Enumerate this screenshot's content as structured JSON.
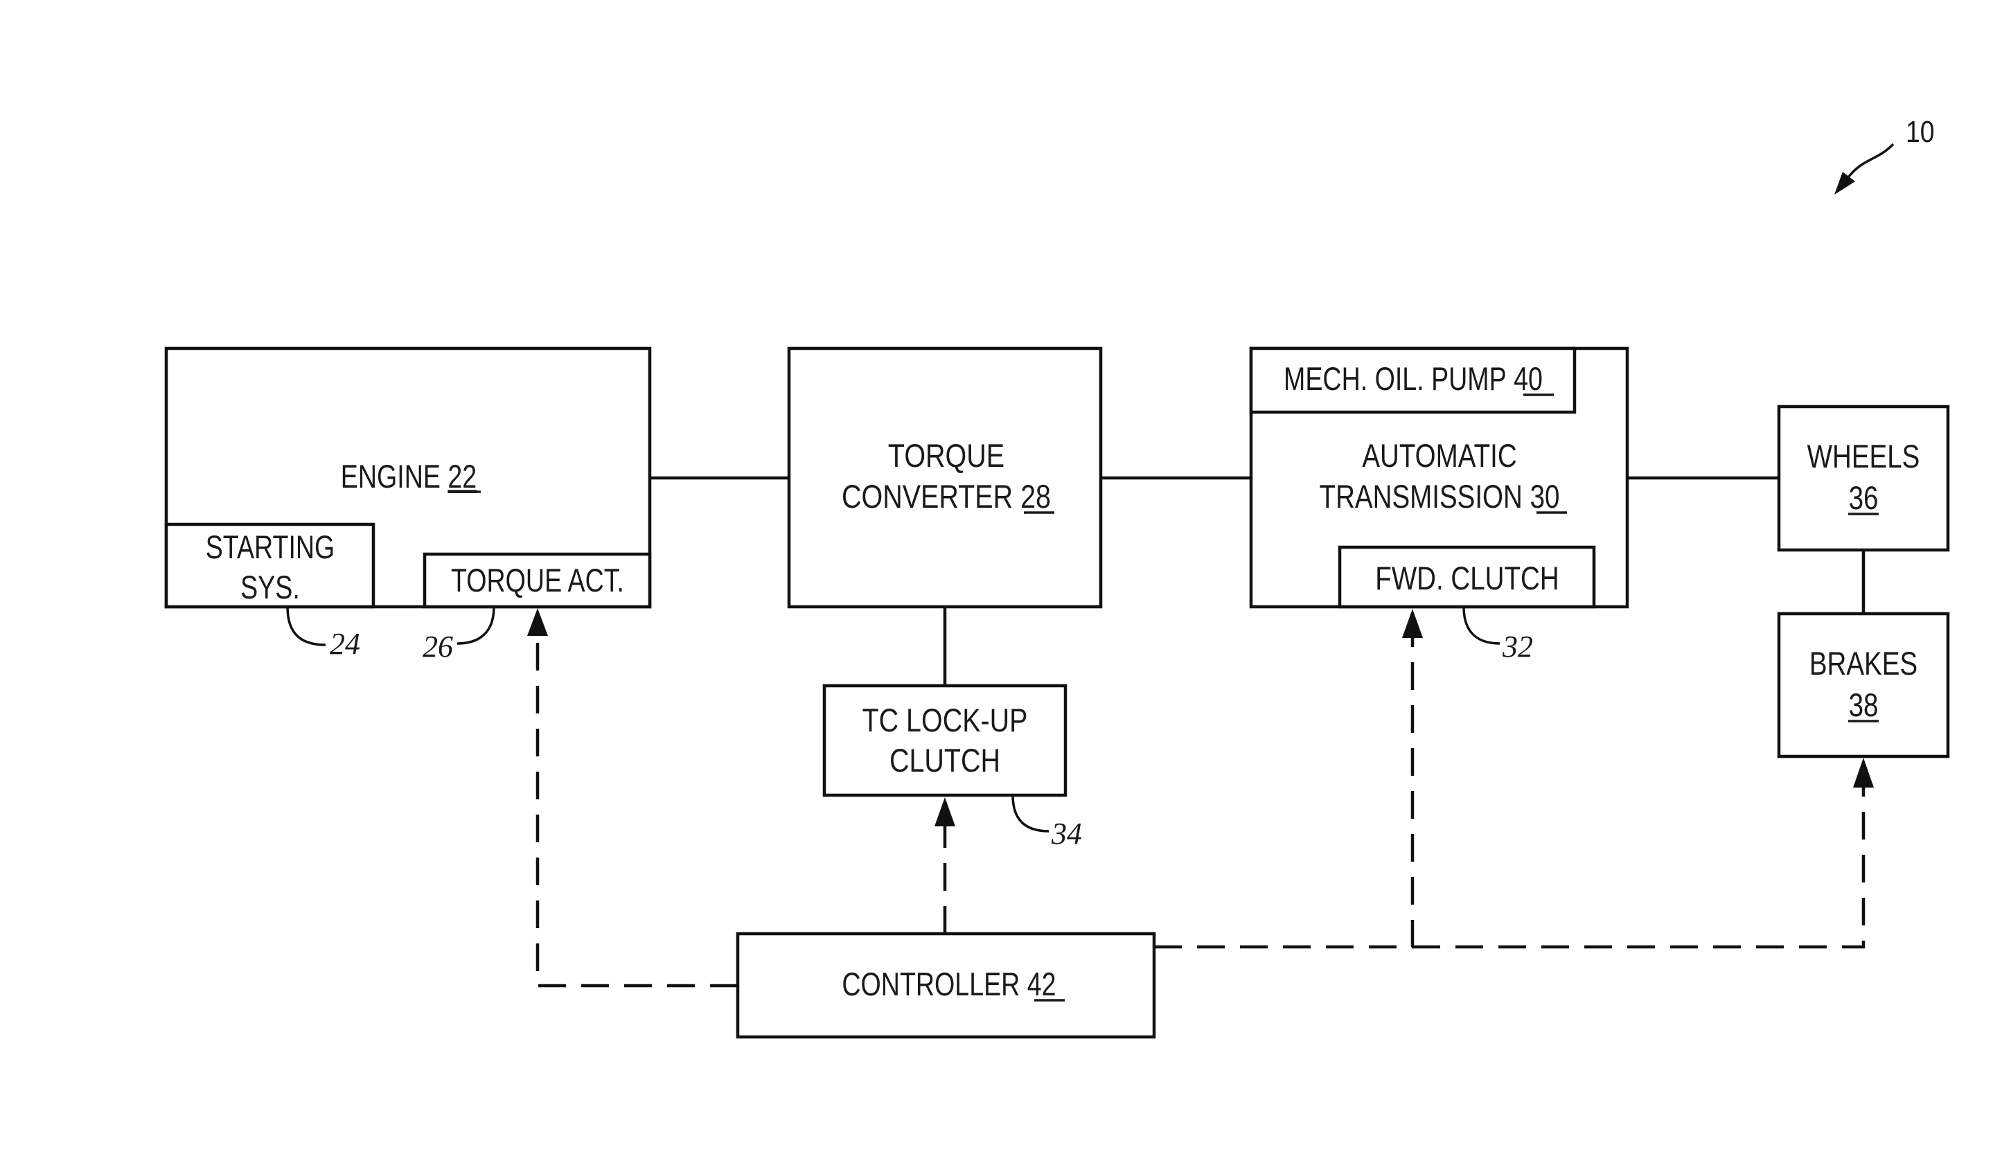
{
  "figure": {
    "reference_numeral": "10",
    "blocks": {
      "engine": {
        "label": "ENGINE",
        "num": "22"
      },
      "starting_system": {
        "line1": "STARTING",
        "line2": "SYS.",
        "ref": "24"
      },
      "torque_actuator": {
        "label": "TORQUE ACT.",
        "ref": "26"
      },
      "torque_converter": {
        "line1": "TORQUE",
        "line2": "CONVERTER",
        "num": "28"
      },
      "tc_lockup_clutch": {
        "line1": "TC LOCK-UP",
        "line2": "CLUTCH",
        "ref": "34"
      },
      "automatic_transmission": {
        "line1": "AUTOMATIC",
        "line2": "TRANSMISSION",
        "num": "30"
      },
      "mech_oil_pump": {
        "label": "MECH. OIL. PUMP",
        "num": "40"
      },
      "forward_clutch": {
        "label": "FWD. CLUTCH",
        "ref": "32"
      },
      "wheels": {
        "label": "WHEELS",
        "num": "36"
      },
      "brakes": {
        "label": "BRAKES",
        "num": "38"
      },
      "controller": {
        "label": "CONTROLLER",
        "num": "42"
      }
    },
    "colors": {
      "ink": "#111111",
      "background": "#ffffff"
    }
  }
}
